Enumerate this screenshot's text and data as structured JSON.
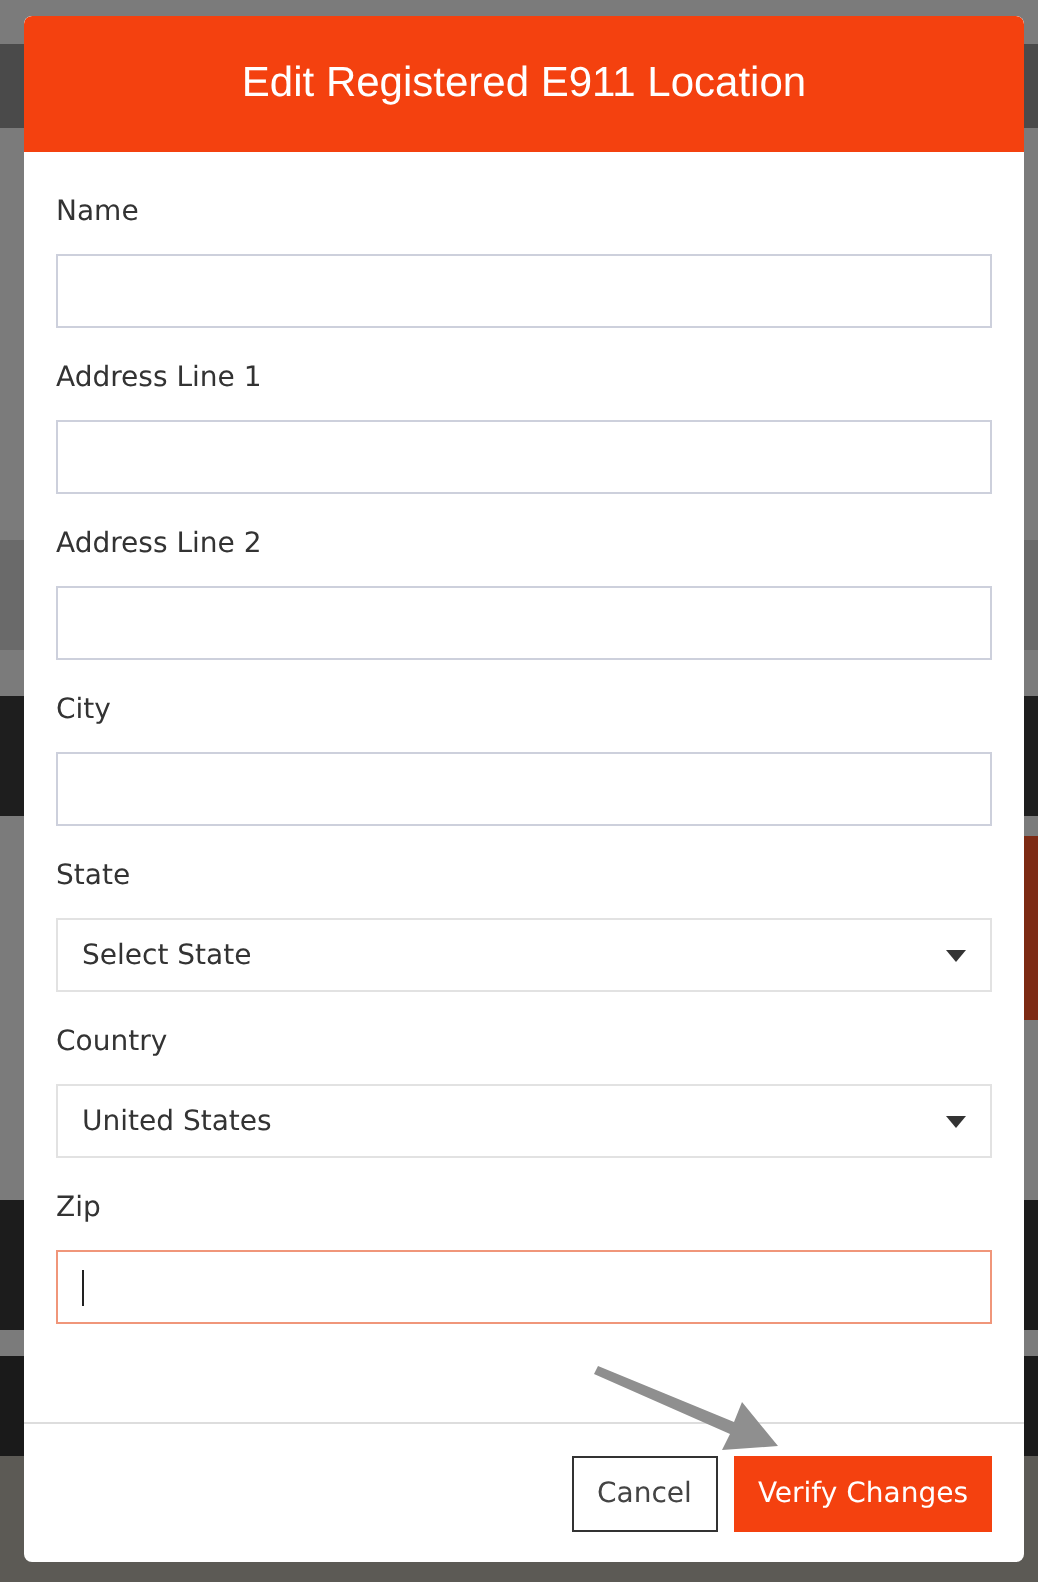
{
  "dialog": {
    "title": "Edit Registered E911 Location",
    "fields": [
      {
        "kind": "text",
        "label": "Name",
        "focused": false
      },
      {
        "kind": "text",
        "label": "Address Line 1",
        "focused": false
      },
      {
        "kind": "text",
        "label": "Address Line 2",
        "focused": false
      },
      {
        "kind": "text",
        "label": "City",
        "focused": false
      },
      {
        "kind": "select",
        "label": "State",
        "value": "Select State",
        "focused": false
      },
      {
        "kind": "select",
        "label": "Country",
        "value": "United States",
        "focused": false
      },
      {
        "kind": "text",
        "label": "Zip",
        "focused": true
      }
    ],
    "buttons": [
      {
        "kind": "secondary",
        "label": "Cancel"
      },
      {
        "kind": "primary",
        "label": "Verify Changes"
      }
    ]
  }
}
